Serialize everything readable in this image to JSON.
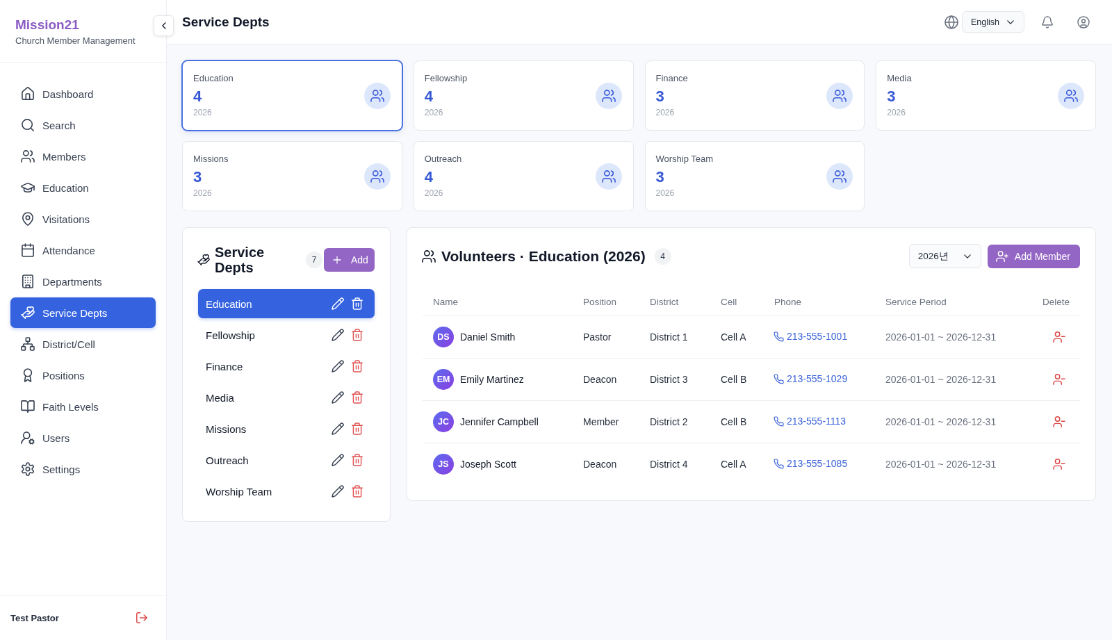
{
  "sidebar": {
    "brand": "Mission21",
    "subtitle": "Church Member Management",
    "items": [
      {
        "label": "Dashboard",
        "selected": false
      },
      {
        "label": "Search",
        "selected": false
      },
      {
        "label": "Members",
        "selected": false
      },
      {
        "label": "Education",
        "selected": false
      },
      {
        "label": "Visitations",
        "selected": false
      },
      {
        "label": "Attendance",
        "selected": false
      },
      {
        "label": "Departments",
        "selected": false
      },
      {
        "label": "Service Depts",
        "selected": true
      },
      {
        "label": "District/Cell",
        "selected": false
      },
      {
        "label": "Positions",
        "selected": false
      },
      {
        "label": "Faith Levels",
        "selected": false
      },
      {
        "label": "Users",
        "selected": false
      },
      {
        "label": "Settings",
        "selected": false
      }
    ],
    "user_name": "Test Pastor"
  },
  "header": {
    "title": "Service Depts",
    "language": "English"
  },
  "department_cards": [
    {
      "name": "Education",
      "count": "4",
      "year": "2026",
      "selected": true
    },
    {
      "name": "Fellowship",
      "count": "4",
      "year": "2026",
      "selected": false
    },
    {
      "name": "Finance",
      "count": "3",
      "year": "2026",
      "selected": false
    },
    {
      "name": "Media",
      "count": "3",
      "year": "2026",
      "selected": false
    },
    {
      "name": "Missions",
      "count": "3",
      "year": "2026",
      "selected": false
    },
    {
      "name": "Outreach",
      "count": "4",
      "year": "2026",
      "selected": false
    },
    {
      "name": "Worship Team",
      "count": "3",
      "year": "2026",
      "selected": false
    }
  ],
  "departments_panel": {
    "title": "Service Depts",
    "count": "7",
    "add_label": "Add",
    "items": [
      {
        "name": "Education",
        "selected": true
      },
      {
        "name": "Fellowship",
        "selected": false
      },
      {
        "name": "Finance",
        "selected": false
      },
      {
        "name": "Media",
        "selected": false
      },
      {
        "name": "Missions",
        "selected": false
      },
      {
        "name": "Outreach",
        "selected": false
      },
      {
        "name": "Worship Team",
        "selected": false
      }
    ]
  },
  "volunteers_panel": {
    "title": "Volunteers · Education (2026)",
    "count": "4",
    "year": "2026년",
    "add_label": "Add Member",
    "columns": [
      "Name",
      "Position",
      "District",
      "Cell",
      "Phone",
      "Service Period",
      "Delete"
    ],
    "rows": [
      {
        "initials": "DS",
        "name": "Daniel Smith",
        "position": "Pastor",
        "district": "District 1",
        "cell": "Cell A",
        "phone": "213-555-1001",
        "service_period": "2026-01-01 ~ 2026-12-31"
      },
      {
        "initials": "EM",
        "name": "Emily Martinez",
        "position": "Deacon",
        "district": "District 3",
        "cell": "Cell B",
        "phone": "213-555-1029",
        "service_period": "2026-01-01 ~ 2026-12-31"
      },
      {
        "initials": "JC",
        "name": "Jennifer Campbell",
        "position": "Member",
        "district": "District 2",
        "cell": "Cell B",
        "phone": "213-555-1113",
        "service_period": "2026-01-01 ~ 2026-12-31"
      },
      {
        "initials": "JS",
        "name": "Joseph Scott",
        "position": "Deacon",
        "district": "District 4",
        "cell": "Cell A",
        "phone": "213-555-1085",
        "service_period": "2026-01-01 ~ 2026-12-31"
      }
    ]
  }
}
